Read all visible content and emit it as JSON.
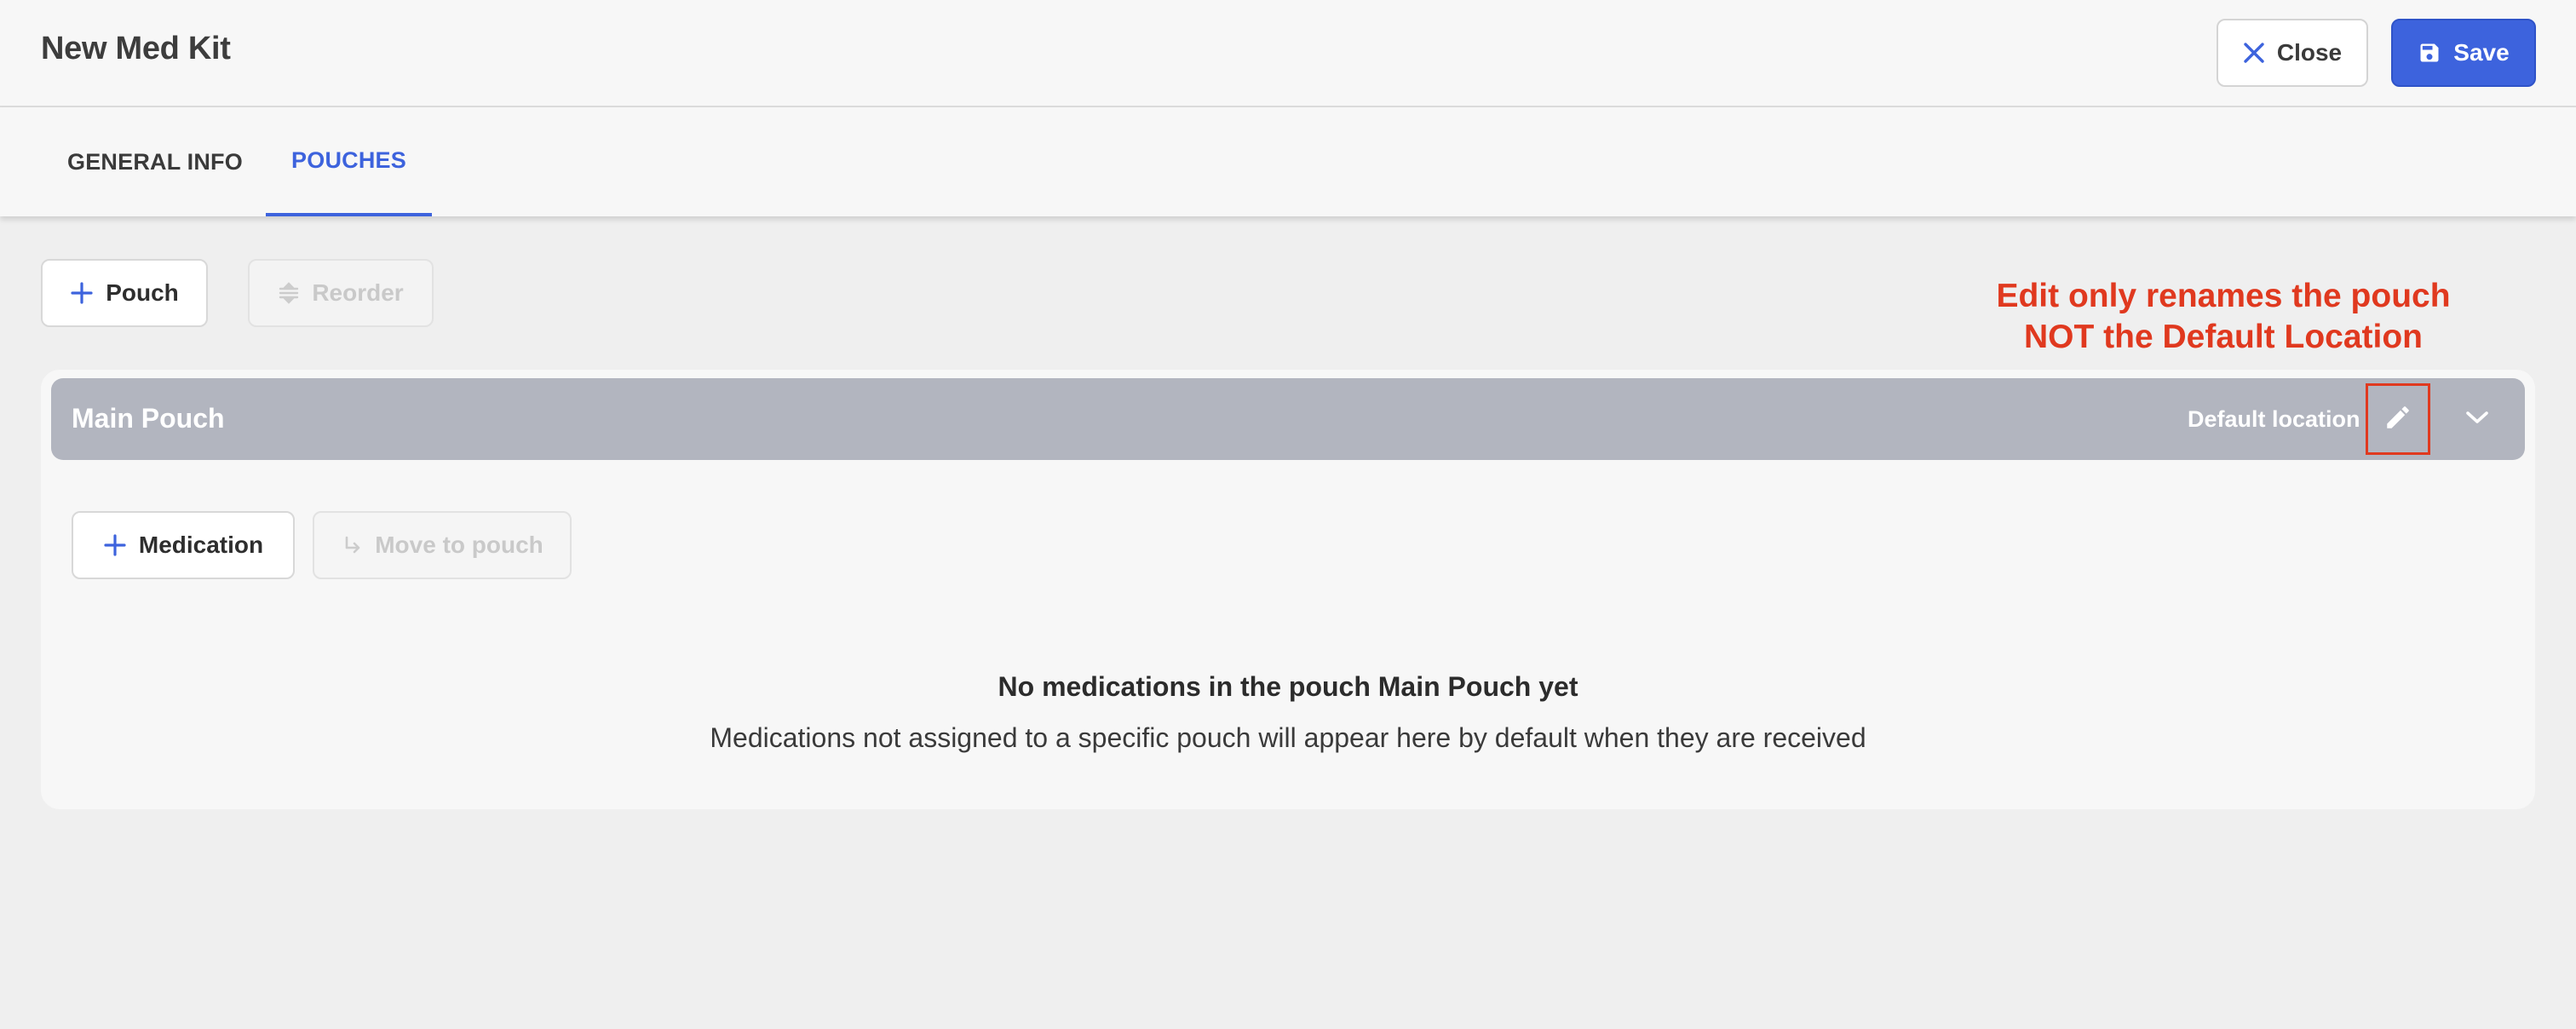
{
  "header": {
    "title": "New Med Kit",
    "close_label": "Close",
    "save_label": "Save"
  },
  "tabs": [
    {
      "label": "GENERAL INFO",
      "active": false
    },
    {
      "label": "POUCHES",
      "active": true
    }
  ],
  "toolbar": {
    "add_pouch_label": "Pouch",
    "reorder_label": "Reorder"
  },
  "annotation": {
    "line1": "Edit only renames the pouch",
    "line2": "NOT the Default Location"
  },
  "pouch": {
    "name": "Main Pouch",
    "default_location_label": "Default location",
    "add_medication_label": "Medication",
    "move_to_pouch_label": "Move to pouch",
    "empty_title": "No medications in the pouch Main Pouch yet",
    "empty_description": "Medications not assigned to a specific pouch will appear here by default when they are received"
  },
  "icons": {
    "close": "close-icon",
    "save": "save-icon",
    "add": "plus-icon",
    "reorder": "reorder-icon",
    "edit": "pencil-icon",
    "expand": "chevron-down-icon",
    "move": "move-arrow-icon"
  },
  "colors": {
    "primary": "#3d63dd",
    "annotation": "#e0391f",
    "pouch_header_bg": "#b2b5bf"
  }
}
